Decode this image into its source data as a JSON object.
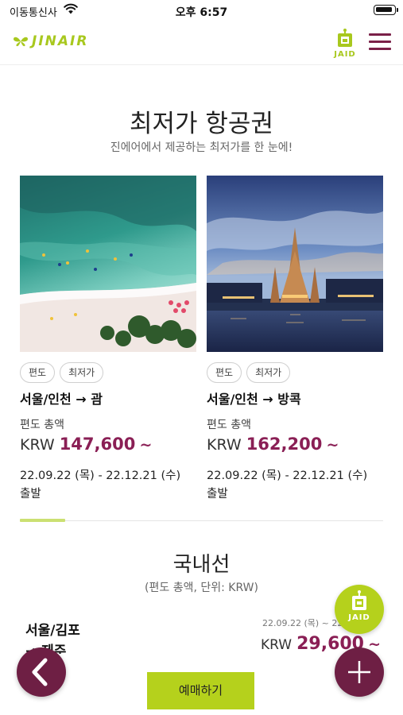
{
  "status_bar": {
    "carrier": "이동통신사",
    "time": "오후 6:57"
  },
  "header": {
    "logo_text": "JINAIR",
    "jaid_label": "JAID"
  },
  "section": {
    "title": "최저가 항공권",
    "subtitle": "진에어에서 제공하는 최저가를 한 눈에!"
  },
  "cards": [
    {
      "tags": [
        "편도",
        "최저가"
      ],
      "route": "서울/인천 → 괌",
      "fare_label": "편도 총액",
      "currency": "KRW",
      "price": "147,600",
      "price_suffix": "~",
      "period": "22.09.22 (목) - 22.12.21 (수)",
      "depart": "출발"
    },
    {
      "tags": [
        "편도",
        "최저가"
      ],
      "route": "서울/인천 → 방콕",
      "fare_label": "편도 총액",
      "currency": "KRW",
      "price": "162,200",
      "price_suffix": "~",
      "period": "22.09.22 (목) - 22.12.21 (수)",
      "depart": "출발"
    }
  ],
  "slider": {
    "active_index": 1,
    "total": 8
  },
  "domestic": {
    "title": "국내선",
    "subtitle": "(편도 총액, 단위: KRW)",
    "route_line1": "서울/김포",
    "route_line2": "→ 제주",
    "period": "22.09.22 (목) ~ 22.12.21",
    "currency": "KRW",
    "price": "29,600",
    "price_suffix": "~"
  },
  "floating": {
    "jaid_label": "JAID",
    "book_label": "예매하기"
  },
  "colors": {
    "brand_green": "#b5d11c",
    "brand_purple": "#6e1f44",
    "price_color": "#8a1f55"
  }
}
